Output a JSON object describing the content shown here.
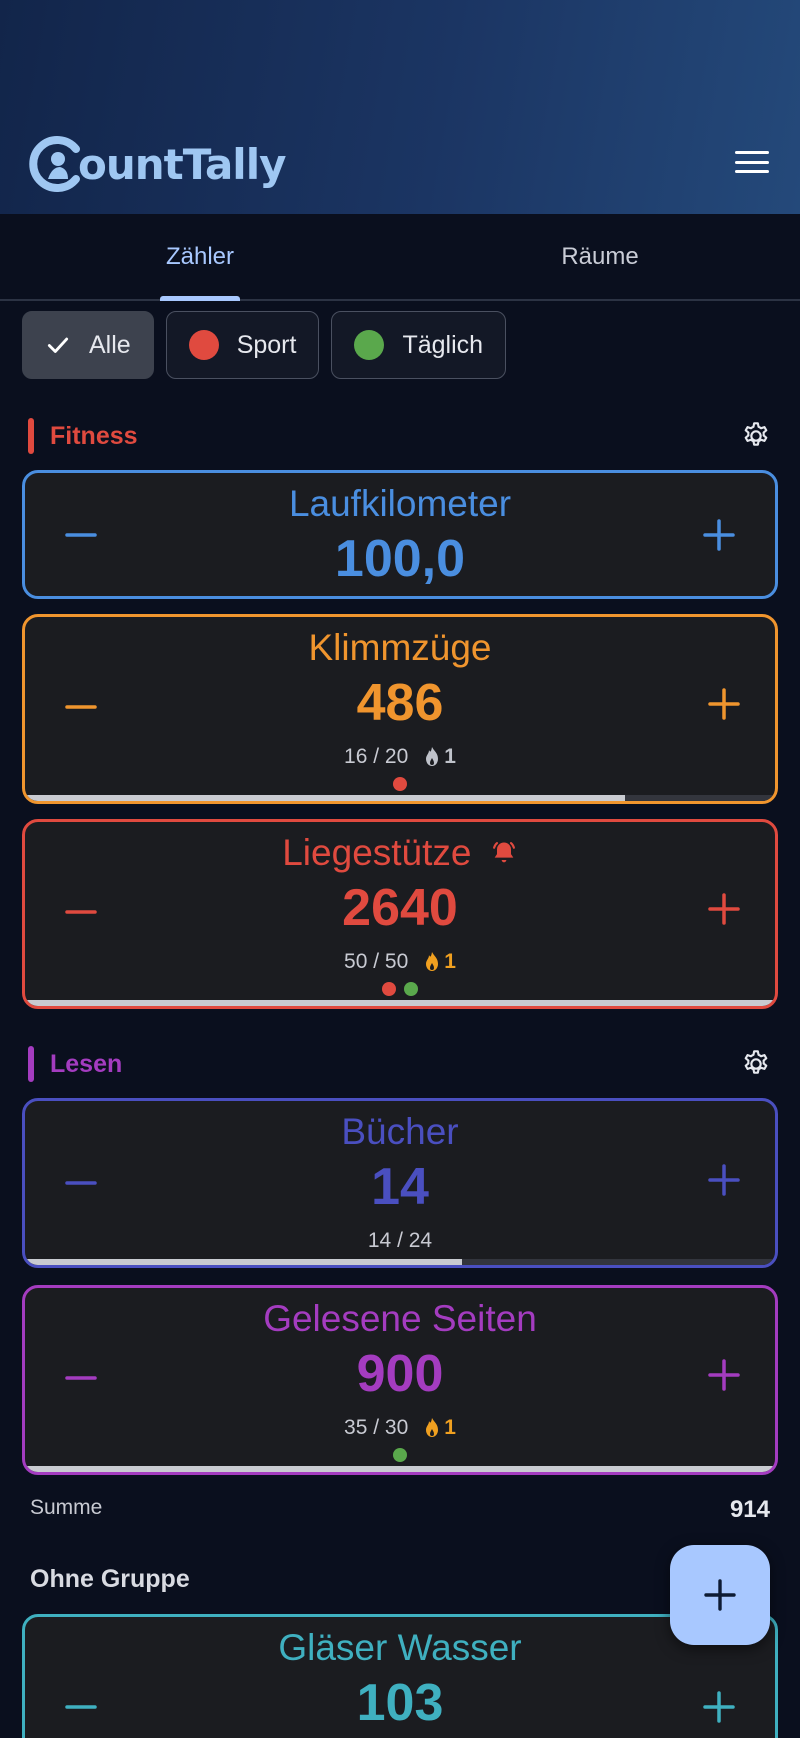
{
  "app": {
    "logo_text": "ountTally",
    "logo_initial": "C"
  },
  "tabs": [
    {
      "label": "Zähler",
      "active": true
    },
    {
      "label": "Räume",
      "active": false
    }
  ],
  "filters": [
    {
      "label": "Alle",
      "selected": true,
      "icon": "check-icon"
    },
    {
      "label": "Sport",
      "selected": false,
      "color": "#e04a3f"
    },
    {
      "label": "Täglich",
      "selected": false,
      "color": "#5aa84c"
    }
  ],
  "groups": [
    {
      "name": "Fitness",
      "color": "#e04a3f",
      "counters": [
        {
          "title": "Laufkilometer",
          "value": "100,0",
          "color": "#4a8ee0"
        },
        {
          "title": "Klimmzüge",
          "value": "486",
          "color": "#f0952e",
          "progress_text": "16 / 20",
          "streak": "1",
          "streak_active": false,
          "tags": [
            "#e04a3f"
          ],
          "progress": 0.8
        },
        {
          "title": "Liegestütze",
          "value": "2640",
          "color": "#e04a3f",
          "has_alarm": true,
          "progress_text": "50 / 50",
          "streak": "1",
          "streak_active": true,
          "tags": [
            "#e04a3f",
            "#5aa84c"
          ],
          "progress": 1.0
        }
      ]
    },
    {
      "name": "Lesen",
      "color": "#a43cc0",
      "sum_label": "Summe",
      "sum_value": "914",
      "counters": [
        {
          "title": "Bücher",
          "value": "14",
          "color": "#4a4fc0",
          "progress_text": "14 / 24",
          "progress": 0.583
        },
        {
          "title": "Gelesene Seiten",
          "value": "900",
          "color": "#a43cc0",
          "progress_text": "35 / 30",
          "streak": "1",
          "streak_active": true,
          "tags": [
            "#5aa84c"
          ],
          "progress": 1.0
        }
      ]
    },
    {
      "name": "Ohne Gruppe",
      "counters": [
        {
          "title": "Gläser Wasser",
          "value": "103",
          "color": "#3fb0c0"
        }
      ]
    }
  ],
  "colors": {
    "accent": "#a8c8ff",
    "streak_active": "#f0a020",
    "streak_inactive": "#bfc2ca"
  }
}
